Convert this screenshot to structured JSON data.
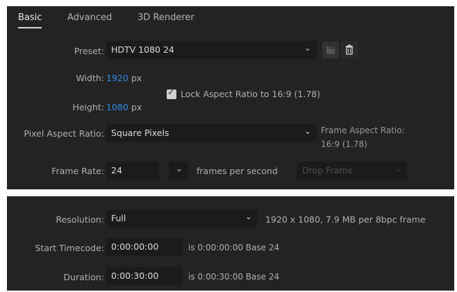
{
  "tabs": [
    {
      "label": "Basic",
      "active": true
    },
    {
      "label": "Advanced",
      "active": false
    },
    {
      "label": "3D Renderer",
      "active": false
    }
  ],
  "preset": {
    "label": "Preset:",
    "value": "HDTV 1080 24"
  },
  "icons": {
    "save_preset": "save-preset-icon",
    "delete_preset": "trash-icon",
    "dropdown": "chevron-down-icon"
  },
  "width": {
    "label": "Width:",
    "value": "1920",
    "unit": "px"
  },
  "height": {
    "label": "Height:",
    "value": "1080",
    "unit": "px"
  },
  "lock_aspect": {
    "label": "Lock Aspect Ratio to 16:9 (1.78)",
    "checked": true
  },
  "pixel_aspect": {
    "label": "Pixel Aspect Ratio:",
    "value": "Square Pixels"
  },
  "frame_aspect": {
    "line1": "Frame Aspect Ratio:",
    "line2": "16:9 (1.78)"
  },
  "frame_rate": {
    "label": "Frame Rate:",
    "value": "24",
    "units": "frames per second",
    "drop_frame": "Drop Frame"
  },
  "resolution": {
    "label": "Resolution:",
    "value": "Full",
    "info": "1920 x 1080, 7.9 MB per 8bpc frame"
  },
  "start_timecode": {
    "label": "Start Timecode:",
    "value": "0:00:00:00",
    "info": "is 0:00:00:00  Base 24"
  },
  "duration": {
    "label": "Duration:",
    "value": "0:00:30:00",
    "info": "is 0:00:30:00  Base 24"
  },
  "colors": {
    "panel_bg": "#232323",
    "field_bg": "#1b1b1b",
    "accent_blue": "#2d8ceb"
  }
}
